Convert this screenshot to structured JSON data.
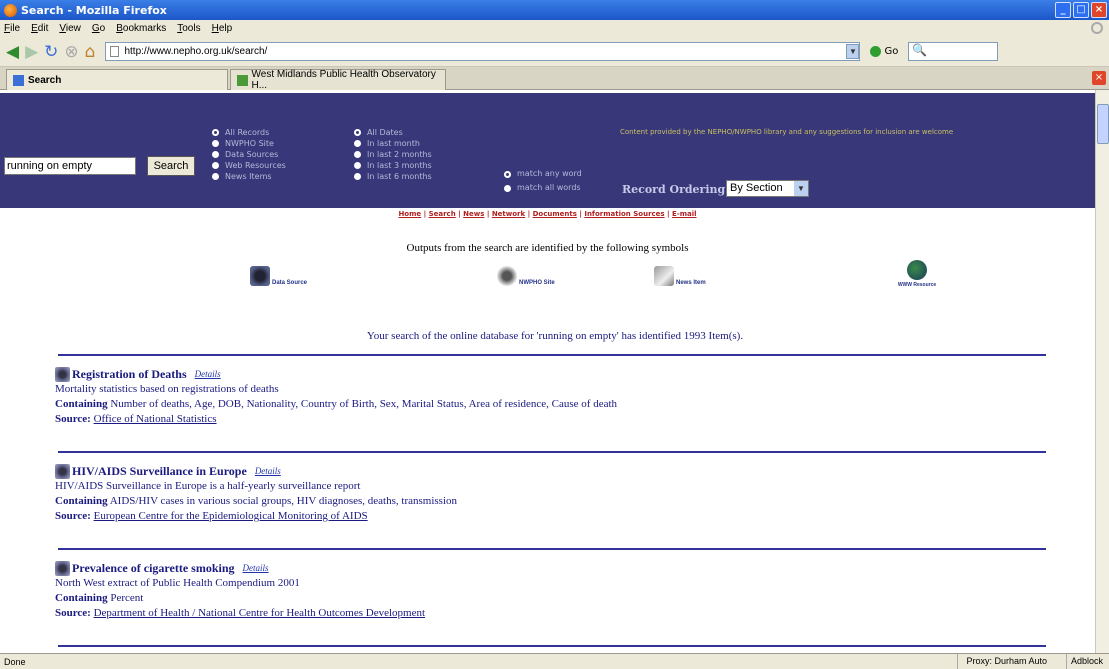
{
  "window": {
    "title": "Search - Mozilla Firefox"
  },
  "menu": [
    "File",
    "Edit",
    "View",
    "Go",
    "Bookmarks",
    "Tools",
    "Help"
  ],
  "address": {
    "url": "http://www.nepho.org.uk/search/",
    "go_label": "Go"
  },
  "tabs": [
    {
      "label": "Search"
    },
    {
      "label": "West Midlands Public Health Observatory H..."
    }
  ],
  "banner": {
    "search_value": "running on empty",
    "search_button": "Search",
    "record_types": [
      "All Records",
      "NWPHO Site",
      "Data Sources",
      "Web Resources",
      "News Items"
    ],
    "date_ranges": [
      "All Dates",
      "In last month",
      "In last 2 months",
      "In last 3 months",
      "In last 6 months"
    ],
    "match_options": [
      "match any word",
      "match all words"
    ],
    "notice": "Content provided by the NEPHO/NWPHO library and any suggestions for inclusion are welcome",
    "record_ordering_label": "Record Ordering",
    "record_ordering_value": "By Section"
  },
  "nav_links": [
    "Home",
    "Search",
    "News",
    "Network",
    "Documents",
    "Information Sources",
    "E-mail"
  ],
  "intro_text": "Outputs from the search are identified by the following symbols",
  "symbols": [
    {
      "label": "Data Source",
      "icon": "data-source-icon"
    },
    {
      "label": "NWPHO Site",
      "icon": "nwpho-site-icon"
    },
    {
      "label": "News Item",
      "icon": "news-item-icon"
    },
    {
      "label": "WWW Resource",
      "icon": "www-resource-icon"
    }
  ],
  "results_summary": "Your search of the online database for 'running on empty' has identified 1993 Item(s).",
  "results": [
    {
      "title": "Registration of Deaths",
      "details": "Details",
      "description": "Mortality statistics based on registrations of deaths",
      "containing_label": "Containing",
      "containing": "Number of deaths, Age, DOB, Nationality, Country of Birth, Sex, Marital Status, Area of residence, Cause of death",
      "source_label": "Source:",
      "source": "Office of National Statistics"
    },
    {
      "title": "HIV/AIDS Surveillance in Europe",
      "details": "Details",
      "description": "HIV/AIDS Surveillance in Europe is a half-yearly surveillance report",
      "containing_label": "Containing",
      "containing": "AIDS/HIV cases in various social groups, HIV diagnoses, deaths, transmission",
      "source_label": "Source:",
      "source": "European Centre for the Epidemiological Monitoring of AIDS"
    },
    {
      "title": "Prevalence of cigarette smoking",
      "details": "Details",
      "description": "North West extract of Public Health Compendium 2001",
      "containing_label": "Containing",
      "containing": "Percent",
      "source_label": "Source:",
      "source": "Department of Health / National Centre for Health Outcomes Development"
    }
  ],
  "status": {
    "left": "Done",
    "proxy": "Proxy: Durham Auto",
    "adblock": "Adblock"
  },
  "colors": {
    "banner": "#37377a",
    "link_red": "#b02020",
    "result_text": "#1a1a80"
  }
}
